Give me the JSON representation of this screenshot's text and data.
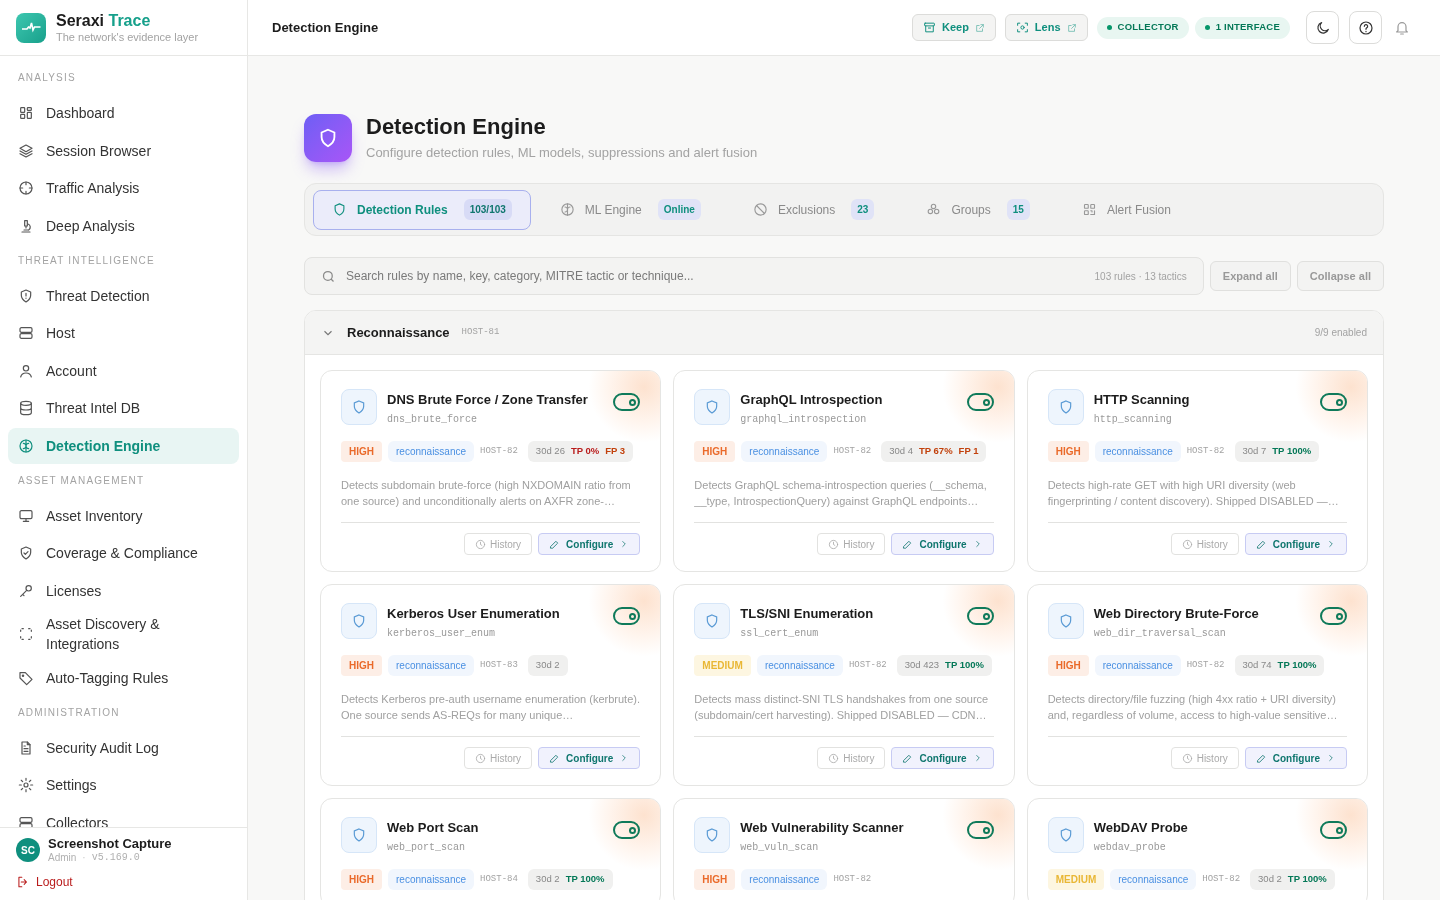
{
  "brand": {
    "name": "Seraxi",
    "accent": "Trace",
    "tagline": "The network's evidence layer"
  },
  "sidebar": {
    "sections": [
      {
        "title": "ANALYSIS",
        "items": [
          {
            "label": "Dashboard",
            "selected": false
          },
          {
            "label": "Session Browser",
            "selected": false
          },
          {
            "label": "Traffic Analysis",
            "selected": false
          },
          {
            "label": "Deep Analysis",
            "selected": false
          }
        ]
      },
      {
        "title": "THREAT INTELLIGENCE",
        "items": [
          {
            "label": "Threat Detection",
            "selected": false
          },
          {
            "label": "Host",
            "selected": false
          },
          {
            "label": "Account",
            "selected": false
          },
          {
            "label": "Threat Intel DB",
            "selected": false
          },
          {
            "label": "Detection Engine",
            "selected": true
          }
        ]
      },
      {
        "title": "ASSET MANAGEMENT",
        "items": [
          {
            "label": "Asset Inventory",
            "selected": false
          },
          {
            "label": "Coverage & Compliance",
            "selected": false
          },
          {
            "label": "Licenses",
            "selected": false
          },
          {
            "label": "Asset Discovery & Integrations",
            "selected": false
          },
          {
            "label": "Auto-Tagging Rules",
            "selected": false
          }
        ]
      },
      {
        "title": "ADMINISTRATION",
        "items": [
          {
            "label": "Security Audit Log",
            "selected": false
          },
          {
            "label": "Settings",
            "selected": false
          },
          {
            "label": "Collectors",
            "selected": false
          }
        ]
      }
    ],
    "user": {
      "initials": "SC",
      "name": "Screenshot Capture",
      "role": "Admin",
      "separator": "·",
      "version": "v5.169.0"
    },
    "logout": "Logout"
  },
  "topbar": {
    "title": "Detection Engine",
    "links": [
      "Keep",
      "Lens"
    ],
    "status": [
      "COLLECTOR",
      "1 INTERFACE"
    ]
  },
  "page": {
    "title": "Detection Engine",
    "subtitle": "Configure detection rules, ML models, suppressions and alert fusion"
  },
  "tabs": [
    {
      "label": "Detection Rules",
      "badge": "103/103",
      "selected": true
    },
    {
      "label": "ML Engine",
      "badge": "Online",
      "selected": false
    },
    {
      "label": "Exclusions",
      "badge": "23",
      "selected": false
    },
    {
      "label": "Groups",
      "badge": "15",
      "selected": false
    },
    {
      "label": "Alert Fusion",
      "selected": false
    }
  ],
  "search": {
    "placeholder": "Search rules by name, key, category, MITRE tactic or technique...",
    "meta": "103 rules · 13 tactics",
    "buttons": [
      "Expand all",
      "Collapse all"
    ]
  },
  "group": {
    "title": "Reconnaissance",
    "host": "HOST-81",
    "expanded": true,
    "count": "9/9 enabled"
  },
  "rules": [
    {
      "title": "DNS Brute Force / Zone Transfer",
      "key": "dns_brute_force",
      "enabled": true,
      "severity": "HIGH",
      "kind": "high",
      "category": "reconnaissance",
      "host": "HOST-82",
      "window": "30d 26",
      "tp": {
        "text": "TP 0%",
        "color": "#b91c1c"
      },
      "fp": "FP 3",
      "description": "Detects subdomain brute-force (high NXDOMAIN ratio from one source) and unconditionally alerts on AXFR zone-…",
      "buttons": [
        "History",
        "Configure"
      ]
    },
    {
      "title": "GraphQL Introspection",
      "key": "graphql_introspection",
      "enabled": true,
      "severity": "HIGH",
      "kind": "high",
      "category": "reconnaissance",
      "host": "HOST-82",
      "window": "30d 4",
      "tp": {
        "text": "TP 67%",
        "color": "#c2410c"
      },
      "fp": "FP 1",
      "description": "Detects GraphQL schema-introspection queries (__schema, __type, IntrospectionQuery) against GraphQL endpoints…",
      "buttons": [
        "History",
        "Configure"
      ]
    },
    {
      "title": "HTTP Scanning",
      "key": "http_scanning",
      "enabled": true,
      "severity": "HIGH",
      "kind": "high",
      "category": "reconnaissance",
      "host": "HOST-82",
      "window": "30d 7",
      "tp": {
        "text": "TP 100%",
        "color": "#047857"
      },
      "description": "Detects high-rate GET with high URI diversity (web fingerprinting / content discovery). Shipped DISABLED —…",
      "buttons": [
        "History",
        "Configure"
      ]
    },
    {
      "title": "Kerberos User Enumeration",
      "key": "kerberos_user_enum",
      "enabled": true,
      "severity": "HIGH",
      "kind": "high",
      "category": "reconnaissance",
      "host": "HOST-83",
      "window": "30d 2",
      "description": "Detects Kerberos pre-auth username enumeration (kerbrute). One source sends AS-REQs for many unique…",
      "buttons": [
        "History",
        "Configure"
      ]
    },
    {
      "title": "TLS/SNI Enumeration",
      "key": "ssl_cert_enum",
      "enabled": true,
      "severity": "MEDIUM",
      "kind": "medium",
      "category": "reconnaissance",
      "host": "HOST-82",
      "window": "30d 423",
      "tp": {
        "text": "TP 100%",
        "color": "#047857"
      },
      "description": "Detects mass distinct-SNI TLS handshakes from one source (subdomain/cert harvesting). Shipped DISABLED — CDN…",
      "buttons": [
        "History",
        "Configure"
      ]
    },
    {
      "title": "Web Directory Brute-Force",
      "key": "web_dir_traversal_scan",
      "enabled": true,
      "severity": "HIGH",
      "kind": "high",
      "category": "reconnaissance",
      "host": "HOST-82",
      "window": "30d 74",
      "tp": {
        "text": "TP 100%",
        "color": "#047857"
      },
      "description": "Detects directory/file fuzzing (high 4xx ratio + URI diversity) and, regardless of volume, access to high-value sensitive…",
      "buttons": [
        "History",
        "Configure"
      ]
    },
    {
      "title": "Web Port Scan",
      "key": "web_port_scan",
      "enabled": true,
      "severity": "HIGH",
      "kind": "high",
      "category": "reconnaissance",
      "host": "HOST-84",
      "window": "30d 2",
      "tp": {
        "text": "TP 100%",
        "color": "#047857"
      }
    },
    {
      "title": "Web Vulnerability Scanner",
      "key": "web_vuln_scan",
      "enabled": true,
      "severity": "HIGH",
      "kind": "high",
      "category": "reconnaissance",
      "host": "HOST-82"
    },
    {
      "title": "WebDAV Probe",
      "key": "webdav_probe",
      "enabled": true,
      "severity": "MEDIUM",
      "kind": "medium",
      "category": "reconnaissance",
      "host": "HOST-82",
      "window": "30d 2",
      "tp": {
        "text": "TP 100%",
        "color": "#047857"
      }
    }
  ]
}
